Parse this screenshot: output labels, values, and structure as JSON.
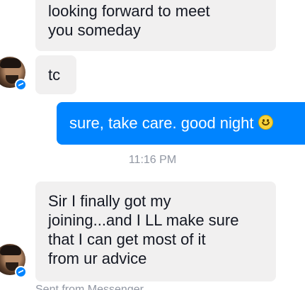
{
  "messages": [
    {
      "direction": "incoming",
      "text": "looking forward to meet\nyou someday"
    },
    {
      "direction": "incoming",
      "text": "tc"
    },
    {
      "direction": "outgoing",
      "text": "sure, take care. good night",
      "emoji": "smiley-emoji"
    },
    {
      "direction": "incoming",
      "text": "Sir I finally got my\njoining...and I LL make sure\nthat I can get most of it\nfrom ur advice"
    }
  ],
  "timestamp": "11:16 PM",
  "footer_hint": "Sent from Messenger",
  "icons": {
    "avatar": "contact-avatar",
    "badge": "messenger-badge-icon",
    "emoji": "smiley-emoji"
  },
  "colors": {
    "outgoing_bubble": "#0084ff",
    "incoming_bubble": "#f1f0f0",
    "timestamp_text": "#9197a3"
  }
}
